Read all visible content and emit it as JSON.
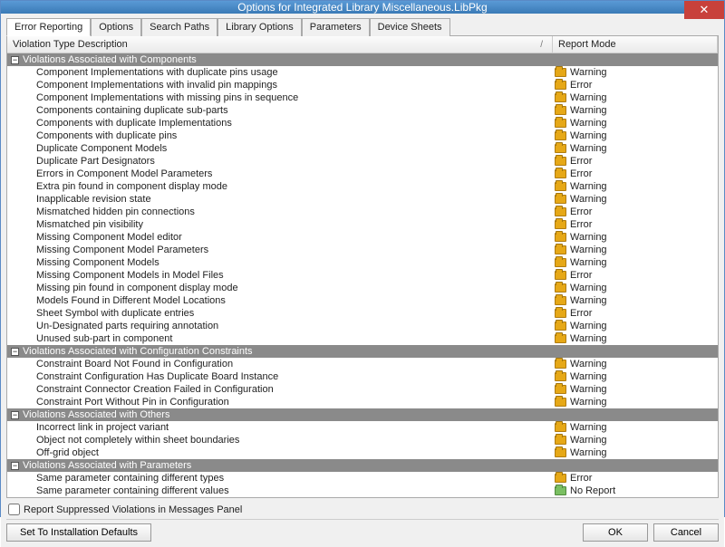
{
  "window": {
    "title": "Options for Integrated Library Miscellaneous.LibPkg"
  },
  "tabs": [
    "Error Reporting",
    "Options",
    "Search Paths",
    "Library Options",
    "Parameters",
    "Device Sheets"
  ],
  "active_tab": 0,
  "columns": {
    "desc": "Violation Type Description",
    "mode": "Report Mode",
    "sort_indicator": "/"
  },
  "groups": [
    {
      "label": "Violations Associated with Components",
      "rows": [
        {
          "desc": "Component Implementations with duplicate pins usage",
          "mode": "Warning"
        },
        {
          "desc": "Component Implementations with invalid pin mappings",
          "mode": "Error"
        },
        {
          "desc": "Component Implementations with missing pins in sequence",
          "mode": "Warning"
        },
        {
          "desc": "Components containing duplicate sub-parts",
          "mode": "Warning"
        },
        {
          "desc": "Components with duplicate Implementations",
          "mode": "Warning"
        },
        {
          "desc": "Components with duplicate pins",
          "mode": "Warning"
        },
        {
          "desc": "Duplicate Component Models",
          "mode": "Warning"
        },
        {
          "desc": "Duplicate Part Designators",
          "mode": "Error"
        },
        {
          "desc": "Errors in Component Model Parameters",
          "mode": "Error"
        },
        {
          "desc": "Extra pin found in component display mode",
          "mode": "Warning"
        },
        {
          "desc": "Inapplicable revision state",
          "mode": "Warning"
        },
        {
          "desc": "Mismatched hidden pin connections",
          "mode": "Error"
        },
        {
          "desc": "Mismatched pin visibility",
          "mode": "Error"
        },
        {
          "desc": "Missing Component Model editor",
          "mode": "Warning"
        },
        {
          "desc": "Missing Component Model Parameters",
          "mode": "Warning"
        },
        {
          "desc": "Missing Component Models",
          "mode": "Warning"
        },
        {
          "desc": "Missing Component Models in Model Files",
          "mode": "Error"
        },
        {
          "desc": "Missing pin found in component display mode",
          "mode": "Warning"
        },
        {
          "desc": "Models Found in Different Model Locations",
          "mode": "Warning"
        },
        {
          "desc": "Sheet Symbol with duplicate entries",
          "mode": "Error"
        },
        {
          "desc": "Un-Designated parts requiring annotation",
          "mode": "Warning"
        },
        {
          "desc": "Unused sub-part in component",
          "mode": "Warning"
        }
      ]
    },
    {
      "label": "Violations Associated with Configuration Constraints",
      "rows": [
        {
          "desc": "Constraint Board Not Found in Configuration",
          "mode": "Warning"
        },
        {
          "desc": "Constraint Configuration Has Duplicate Board Instance",
          "mode": "Warning"
        },
        {
          "desc": "Constraint Connector Creation Failed in Configuration",
          "mode": "Warning"
        },
        {
          "desc": "Constraint Port Without Pin in Configuration",
          "mode": "Warning"
        }
      ]
    },
    {
      "label": "Violations Associated with Others",
      "rows": [
        {
          "desc": "Incorrect link in project variant",
          "mode": "Warning"
        },
        {
          "desc": "Object not completely within sheet boundaries",
          "mode": "Warning"
        },
        {
          "desc": "Off-grid object",
          "mode": "Warning"
        }
      ]
    },
    {
      "label": "Violations Associated with Parameters",
      "rows": [
        {
          "desc": "Same parameter containing different types",
          "mode": "Error"
        },
        {
          "desc": "Same parameter containing different values",
          "mode": "No Report"
        }
      ]
    }
  ],
  "checkbox": {
    "label": "Report Suppressed Violations in Messages Panel",
    "checked": false
  },
  "buttons": {
    "defaults": "Set To Installation Defaults",
    "ok": "OK",
    "cancel": "Cancel"
  }
}
